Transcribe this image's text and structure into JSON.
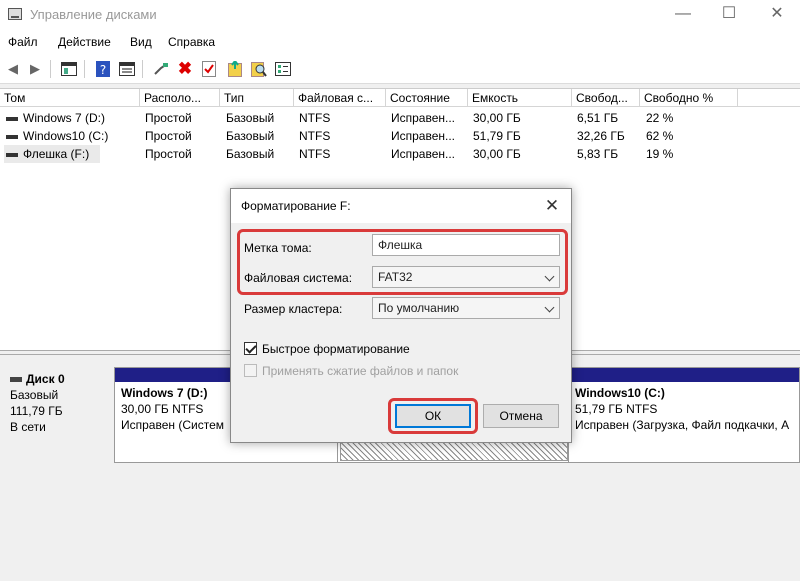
{
  "window": {
    "title": "Управление дисками",
    "minimize": "—",
    "maximize": "☐",
    "close": "✕"
  },
  "menu": [
    "Файл",
    "Действие",
    "Вид",
    "Справка"
  ],
  "toolbar_icons": [
    "back-arrow-icon",
    "forward-arrow-icon",
    "panel-icon",
    "help-icon",
    "properties-icon",
    "connect-icon",
    "delete-icon",
    "check-icon",
    "new-icon",
    "search-icon",
    "list-icon"
  ],
  "table": {
    "columns": [
      "Том",
      "Располо...",
      "Тип",
      "Файловая с...",
      "Состояние",
      "Емкость",
      "Свобод...",
      "Свободно %"
    ],
    "rows": [
      [
        "Windows 7 (D:)",
        "Простой",
        "Базовый",
        "NTFS",
        "Исправен...",
        "30,00 ГБ",
        "6,51 ГБ",
        "22 %"
      ],
      [
        "Windows10 (C:)",
        "Простой",
        "Базовый",
        "NTFS",
        "Исправен...",
        "51,79 ГБ",
        "32,26 ГБ",
        "62 %"
      ],
      [
        "Флешка (F:)",
        "Простой",
        "Базовый",
        "NTFS",
        "Исправен...",
        "30,00 ГБ",
        "5,83 ГБ",
        "19 %"
      ]
    ]
  },
  "disk": {
    "name": "Диск 0",
    "type": "Базовый",
    "size": "111,79 ГБ",
    "status": "В сети"
  },
  "partitions": [
    {
      "title": "Windows 7  (D:)",
      "size": "30,00 ГБ NTFS",
      "status": "Исправен (Систем"
    },
    {
      "title": "Windows10  (C:)",
      "size": "51,79 ГБ NTFS",
      "status": "Исправен (Загрузка, Файл подкачки, А"
    }
  ],
  "dialog": {
    "title": "Форматирование F:",
    "close": "✕",
    "volume_label_caption": "Метка тома:",
    "volume_label_value": "Флешка",
    "fs_caption": "Файловая система:",
    "fs_value": "FAT32",
    "cluster_caption": "Размер кластера:",
    "cluster_value": "По умолчанию",
    "quick_format": "Быстрое форматирование",
    "quick_format_checked": true,
    "compression": "Применять сжатие файлов и папок",
    "compression_enabled": false,
    "ok": "ОК",
    "cancel": "Отмена"
  },
  "colors": {
    "highlight": "#d93a3a",
    "partition_bar": "#1f1f87",
    "primary_button_border": "#0078d7"
  }
}
